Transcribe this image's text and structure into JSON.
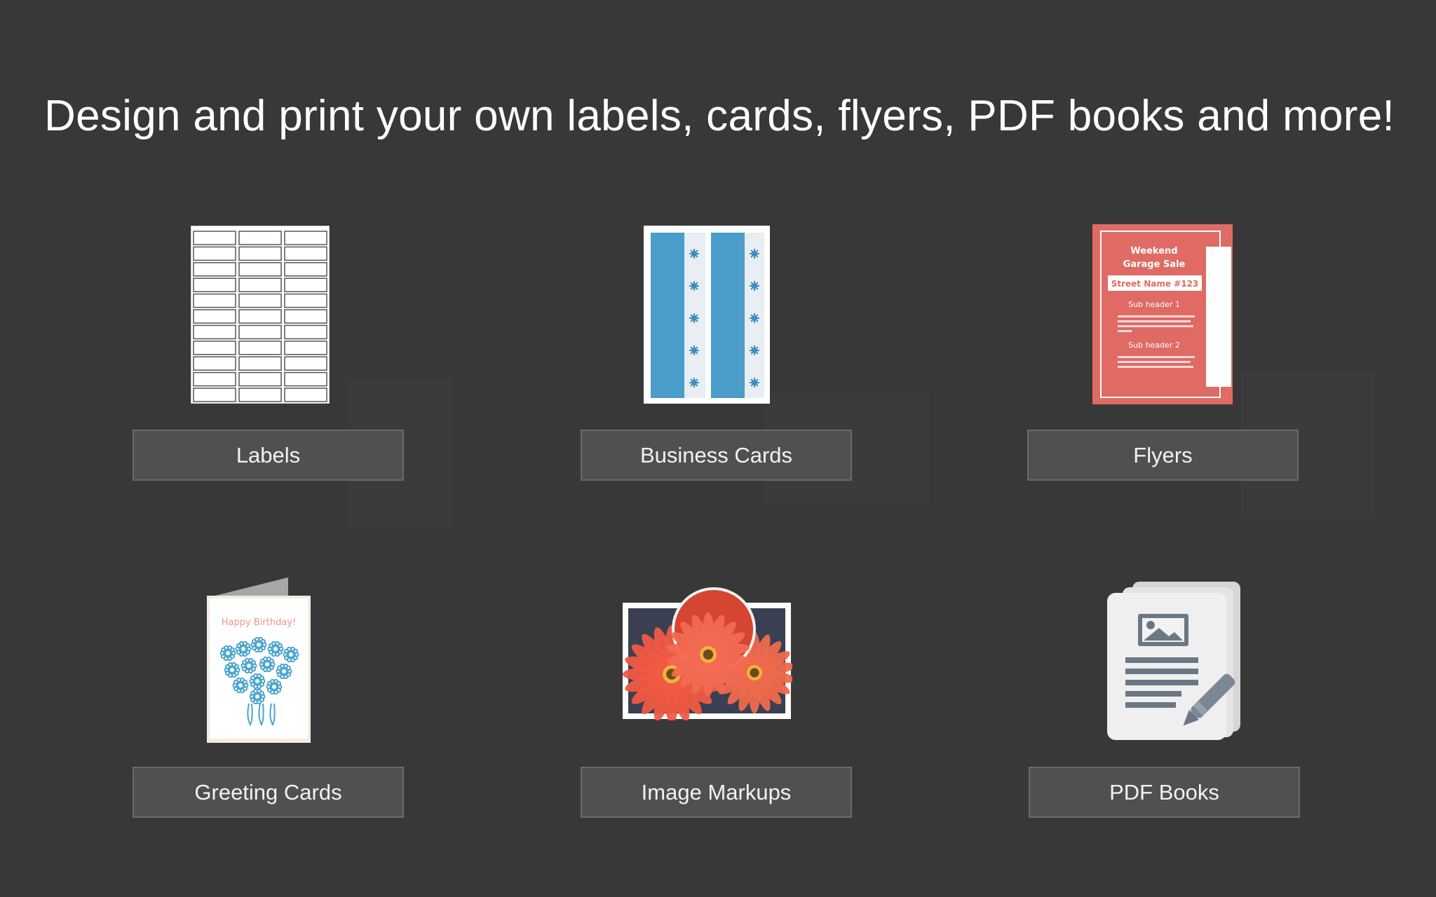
{
  "header": {
    "title": "Design and print your own labels, cards, flyers, PDF books and more!"
  },
  "tiles": [
    {
      "label": "Labels",
      "icon": "labels-sheet-icon"
    },
    {
      "label": "Business Cards",
      "icon": "business-cards-sheet-icon"
    },
    {
      "label": "Flyers",
      "icon": "flyer-icon"
    },
    {
      "label": "Greeting Cards",
      "icon": "greeting-card-icon"
    },
    {
      "label": "Image Markups",
      "icon": "image-markup-icon"
    },
    {
      "label": "PDF Books",
      "icon": "pdf-book-icon"
    }
  ],
  "flyer": {
    "title_line1": "Weekend",
    "title_line2": "Garage Sale",
    "street": "Street Name #123",
    "sub1": "Sub header 1",
    "sub2": "Sub header 2"
  },
  "greeting": {
    "text": "Happy Birthday!"
  },
  "colors": {
    "background": "#383838",
    "button": "#505050",
    "button_border": "#6a6a6a",
    "flyer_red": "#e06a64",
    "card_blue": "#4a9cc9"
  }
}
